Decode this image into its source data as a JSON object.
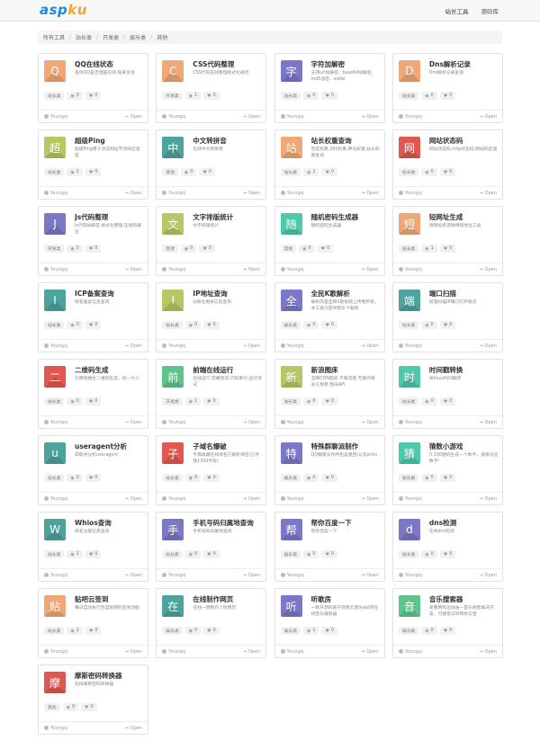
{
  "header": {
    "brand_part1": "asp",
    "brand_part2": "ku",
    "nav": [
      {
        "label": "站长工具"
      },
      {
        "label": "源码库"
      }
    ]
  },
  "breadcrumb": [
    "所有工具",
    "站长类",
    "开发类",
    "娱乐类",
    "其他"
  ],
  "open_label": "Open",
  "cards": [
    {
      "glyph": "Q",
      "color": "#f0a878",
      "title": "QQ在线状态",
      "desc": "查询QQ是否电脑在线,隐身会话",
      "tag": "站长类",
      "views": "0",
      "likes": "0",
      "author": "Youngsj"
    },
    {
      "glyph": "C",
      "color": "#f0a878",
      "title": "CSS代码整理",
      "desc": "CSS代码在线整理格式化规范",
      "tag": "开发类",
      "views": "1",
      "likes": "0",
      "author": "Youngsj"
    },
    {
      "glyph": "字",
      "color": "#7b78c8",
      "title": "字符加解密",
      "desc": "支持url加解密、base64加解密、md5加密、addsl",
      "tag": "站长类",
      "views": "0",
      "likes": "0",
      "author": "Youngsj"
    },
    {
      "glyph": "D",
      "color": "#f0a878",
      "title": "Dns解析记录",
      "desc": "Dns解析记录查询",
      "tag": "站长类",
      "views": "0",
      "likes": "0",
      "author": "Youngsj"
    },
    {
      "glyph": "超",
      "color": "#b5c864",
      "title": "超级Ping",
      "desc": "超级Ping用于测试网站节点响应速度",
      "tag": "站长类",
      "views": "1",
      "likes": "0",
      "author": "Youngsj"
    },
    {
      "glyph": "中",
      "color": "#4ea39c",
      "title": "中文转拼音",
      "desc": "在线中文转拼音",
      "tag": "其他",
      "views": "0",
      "likes": "0",
      "author": "Youngsj"
    },
    {
      "glyph": "站",
      "color": "#f0a878",
      "title": "站长权重查询",
      "desc": "百度权重,360权重,神马权重,站长权重查询",
      "tag": "站长类",
      "views": "2",
      "likes": "0",
      "author": "Youngsj"
    },
    {
      "glyph": "网",
      "color": "#e0584f",
      "title": "网站状态码",
      "desc": "网站状态码,http状态码,网站响应值",
      "tag": "站长类",
      "views": "0",
      "likes": "0",
      "author": "Youngsj"
    },
    {
      "glyph": "J",
      "color": "#7b78c8",
      "title": "Js代码整理",
      "desc": "Js代码加解密,格式化整理,压缩和解压",
      "tag": "开发类",
      "views": "0",
      "likes": "0",
      "author": "Youngsj"
    },
    {
      "glyph": "文",
      "color": "#b5c864",
      "title": "文字排版统计",
      "desc": "文字排版统计",
      "tag": "其他",
      "views": "0",
      "likes": "0",
      "author": "Youngsj"
    },
    {
      "glyph": "随",
      "color": "#4ec9a9",
      "title": "随机密码生成器",
      "desc": "随机密码生成器",
      "tag": "其他",
      "views": "0",
      "likes": "0",
      "author": "Youngsj"
    },
    {
      "glyph": "短",
      "color": "#f0a878",
      "title": "短网址生成",
      "desc": "短网址新浪微博短地址工具",
      "tag": "站长类",
      "views": "1",
      "likes": "0",
      "author": "Youngsj"
    },
    {
      "glyph": "I",
      "color": "#4ea39c",
      "title": "ICP备案查询",
      "desc": "域名备案信息查询",
      "tag": "站长类",
      "views": "0",
      "likes": "0",
      "author": "Youngsj"
    },
    {
      "glyph": "I",
      "color": "#b5c864",
      "title": "IP地址查询",
      "desc": "ip地址相关信息查询",
      "tag": "站长类",
      "views": "0",
      "likes": "0",
      "author": "Youngsj"
    },
    {
      "glyph": "全",
      "color": "#7b78c8",
      "title": "全民K歌解析",
      "desc": "解析的是全民K歌视频上传者所有。本工具只提供音乐下载地",
      "tag": "娱乐类",
      "views": "0",
      "likes": "0",
      "author": "Youngsj"
    },
    {
      "glyph": "端",
      "color": "#4ea39c",
      "title": "端口扫描",
      "desc": "批量扫描IP端口打开情况",
      "tag": "站长类",
      "views": "0",
      "likes": "0",
      "author": "Youngsj"
    },
    {
      "glyph": "二",
      "color": "#e0584f",
      "title": "二维码生成",
      "desc": "方便快捷生二维码生成，统一大小",
      "tag": "站长类",
      "views": "0",
      "likes": "0",
      "author": "Youngsj"
    },
    {
      "glyph": "前",
      "color": "#5fc48b",
      "title": "前端在线运行",
      "desc": "在线运行 前端测试,代码审计,运行测试",
      "tag": "开发类",
      "views": "1",
      "likes": "0",
      "author": "Youngsj"
    },
    {
      "glyph": "新",
      "color": "#b5c864",
      "title": "新浪图床",
      "desc": "全网CDN图床 不限流量 无限外链 永久免费 图床API",
      "tag": "站长类",
      "views": "0",
      "likes": "0",
      "author": "Youngsj"
    },
    {
      "glyph": "时",
      "color": "#4ec9a9",
      "title": "时间戳转换",
      "desc": "将linux时间戳转",
      "tag": "站长类",
      "views": "0",
      "likes": "0",
      "author": "Youngsj"
    },
    {
      "glyph": "u",
      "color": "#4ea39c",
      "title": "useragent分析",
      "desc": "获取并分析useragent",
      "tag": "站长类",
      "views": "0",
      "likes": "0",
      "author": "Youngsj"
    },
    {
      "glyph": "子",
      "color": "#e0584f",
      "title": "子域名爆破",
      "desc": "字典收藏在线域名已解析域名(已存放1393字段)",
      "tag": "站长类",
      "views": "0",
      "likes": "0",
      "author": "Youngsj"
    },
    {
      "glyph": "特",
      "color": "#7b78c8",
      "title": "特殊群聊派制作",
      "desc": "QQ群聊天时所包含建回(以及echo",
      "tag": "娱乐类",
      "views": "0",
      "likes": "0",
      "author": "Youngsj"
    },
    {
      "glyph": "猜",
      "color": "#4ec9a9",
      "title": "猜数小游戏",
      "desc": "0-100随机生成一个数字，请猜对这数字！",
      "tag": "娱乐类",
      "views": "0",
      "likes": "0",
      "author": "Youngsj"
    },
    {
      "glyph": "W",
      "color": "#4ea39c",
      "title": "Whios查询",
      "desc": "域名注册信息查询",
      "tag": "站长类",
      "views": "2",
      "likes": "0",
      "author": "Youngsj"
    },
    {
      "glyph": "手",
      "color": "#7b78c8",
      "title": "手机号码归属地查询",
      "desc": "手机号码归属地查询",
      "tag": "站长类",
      "views": "0",
      "likes": "0",
      "author": "Youngsj"
    },
    {
      "glyph": "帮",
      "color": "#7b78c8",
      "title": "帮你百度一下",
      "desc": "帮你百度一下",
      "tag": "娱乐类",
      "views": "0",
      "likes": "0",
      "author": "Youngsj"
    },
    {
      "glyph": "d",
      "color": "#7b78c8",
      "title": "dns检测",
      "desc": "在线dns检测",
      "tag": "站长类",
      "views": "0",
      "likes": "0",
      "author": "Youngsj"
    },
    {
      "glyph": "贴",
      "color": "#f0a878",
      "title": "贴吧云签到",
      "desc": "每日自动执行百度贴吧的签到功能",
      "tag": "站长类",
      "views": "1",
      "likes": "0",
      "author": "Youngsj"
    },
    {
      "glyph": "在",
      "color": "#4ea39c",
      "title": "在线制作网页",
      "desc": "在线一键制作个性网页",
      "tag": "娱乐类",
      "views": "0",
      "likes": "0",
      "author": "Youngsj"
    },
    {
      "glyph": "听",
      "color": "#7b78c8",
      "title": "听歌房",
      "desc": "一款开源的基于网易云音乐api的在线音乐播放器",
      "tag": "娱乐类",
      "views": "1",
      "likes": "0",
      "author": "Youngsj"
    },
    {
      "glyph": "音",
      "color": "#5fc48b",
      "title": "音乐搜索器",
      "desc": "爱整网和出站由一首乐搜索解决方案，可搜索试听网易云音",
      "tag": "娱乐类",
      "views": "0",
      "likes": "0",
      "author": "Youngsj"
    },
    {
      "glyph": "摩",
      "color": "#e0584f",
      "title": "摩斯密码转换器",
      "desc": "在线摩斯密码转换器",
      "tag": "其他",
      "views": "0",
      "likes": "0",
      "author": "Youngsj"
    }
  ]
}
